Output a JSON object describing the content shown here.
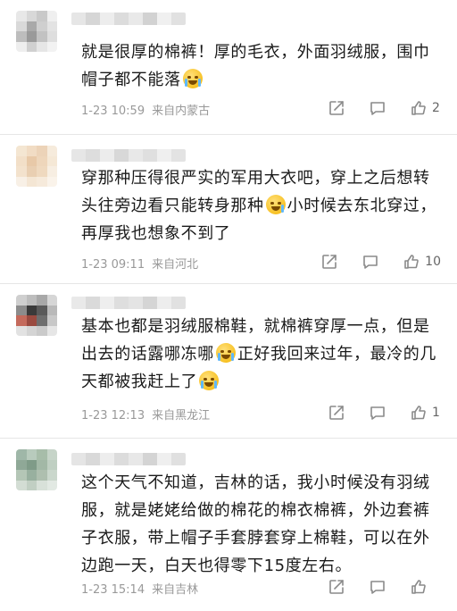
{
  "comments": [
    {
      "text_before": "就是很厚的棉裤！厚的毛衣，外面羽绒服，围巾帽子都不能落",
      "emoji1": "laugh-cry",
      "text_middle": "",
      "emoji2": "",
      "text_after": "",
      "time": "1-23 10:59",
      "source": "来自内蒙古",
      "likes": "2",
      "avatar_colors": [
        "#e8e8e8",
        "#d8d8d8",
        "#c9c9c9",
        "#efefef",
        "#d9d9d9",
        "#a9a9a9",
        "#cfcfcf",
        "#e3e3e3",
        "#bdbdbd",
        "#9a9a9a",
        "#c2c2c2",
        "#dedede",
        "#eeeeee",
        "#d0d0d0",
        "#e6e6e6",
        "#f2f2f2"
      ],
      "name_colors": [
        "#e6e6e6",
        "#d6d6d6",
        "#ededed",
        "#dcdcdc",
        "#e9e9e9",
        "#d2d2d2",
        "#f0f0f0",
        "#e1e1e1"
      ]
    },
    {
      "text_before": "穿那种压得很严实的军用大衣吧，穿上之后想转头往旁边看只能转身那种",
      "emoji1": "sweat",
      "text_middle": "小时候去东北穿过，再厚我也想象不到了",
      "emoji2": "",
      "text_after": "",
      "time": "1-23 09:11",
      "source": "来自河北",
      "likes": "10",
      "avatar_colors": [
        "#f4e6d2",
        "#f1dcc4",
        "#ecd3b8",
        "#f6ebdc",
        "#f2dfc8",
        "#e8c9a8",
        "#eed6bb",
        "#f5e8d6",
        "#f3e2cd",
        "#e9cfb2",
        "#efd9bf",
        "#f7eee2",
        "#f8f0e6",
        "#f4e6d4",
        "#f6eadb",
        "#faf3ea"
      ],
      "name_colors": [
        "#e6e6e6",
        "#dddddd",
        "#ececec",
        "#d8d8d8",
        "#e8e8e8",
        "#dfdfdf",
        "#efefef",
        "#e3e3e3"
      ]
    },
    {
      "text_before": "基本也都是羽绒服棉鞋，就棉裤穿厚一点，但是出去的话露哪冻哪",
      "emoji1": "laugh-cry",
      "text_middle": "正好我回来过年，最冷的几天都被我赶上了",
      "emoji2": "crying",
      "text_after": "",
      "time": "1-23 12:13",
      "source": "来自黑龙江",
      "likes": "1",
      "avatar_colors": [
        "#cfcfcf",
        "#bdbdbd",
        "#a8a8a8",
        "#d6d6d6",
        "#8c8c8c",
        "#3a3a3a",
        "#5a5a5a",
        "#b9b9b9",
        "#c46a5c",
        "#9a4a40",
        "#6e6e6e",
        "#c8c8c8",
        "#e2e2e2",
        "#d4d4d4",
        "#cacaca",
        "#e6e6e6"
      ],
      "name_colors": [
        "#e9e9e9",
        "#dadada",
        "#eeeeee",
        "#dedede",
        "#e4e4e4",
        "#d5d5d5",
        "#ededed",
        "#e1e1e1"
      ]
    },
    {
      "text_before": "这个天气不知道，吉林的话，我小时候没有羽绒服，就是姥姥给做的棉花的棉衣棉裤，外边套裤子衣服，带上帽子手套脖套穿上棉鞋，可以在外边跑一天，白天也得零下15度左右。",
      "emoji1": "",
      "text_middle": "",
      "emoji2": "",
      "text_after": "",
      "time": "1-23 15:14",
      "source": "来自吉林",
      "likes": "",
      "avatar_colors": [
        "#9fb7a8",
        "#b8cbbd",
        "#a7bda9",
        "#c6d4c8",
        "#8fa897",
        "#7f9b88",
        "#a2b8a6",
        "#bfcfc2",
        "#b4c6b6",
        "#98b09f",
        "#aebfaf",
        "#cad7cc",
        "#d3ddd4",
        "#c1cfc3",
        "#d8e1d9",
        "#e2e9e3"
      ],
      "name_colors": [
        "#e5e5e5",
        "#d9d9d9",
        "#ededed",
        "#dcdcdc",
        "#e8e8e8",
        "#d4d4d4",
        "#efefef",
        "#e0e0e0"
      ]
    }
  ],
  "icons": {
    "share": "share-icon",
    "comment": "comment-icon",
    "like": "thumbs-up-icon"
  }
}
